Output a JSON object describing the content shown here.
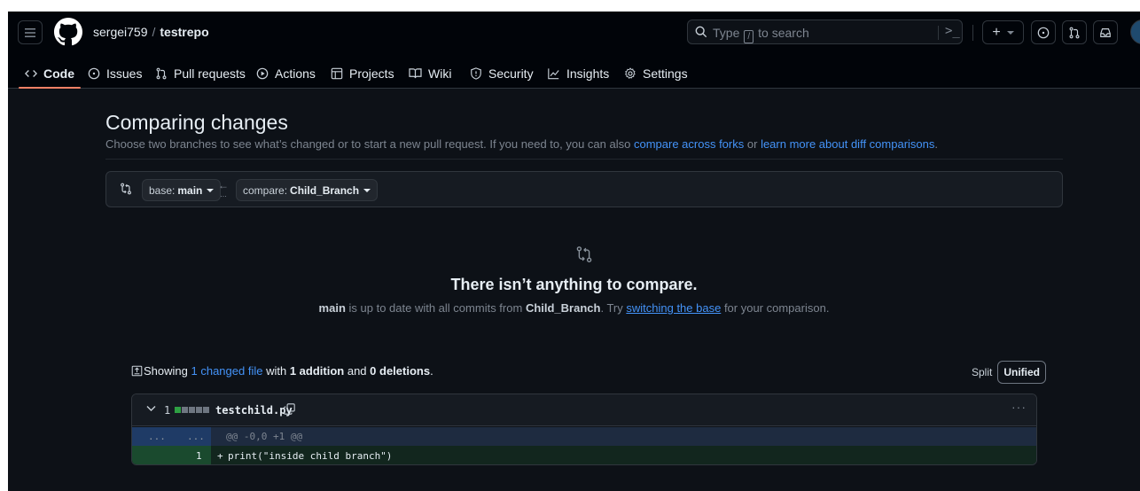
{
  "header": {
    "owner": "sergei759",
    "separator": "/",
    "repo": "testrepo",
    "search_placeholder_pre": "Type",
    "search_key": "/",
    "search_placeholder_post": "to search",
    "command_glyph": ">_",
    "plus_label": "+"
  },
  "tabs": [
    {
      "label": "Code",
      "icon": "code-icon",
      "active": true
    },
    {
      "label": "Issues",
      "icon": "issue-icon"
    },
    {
      "label": "Pull requests",
      "icon": "pull-request-icon"
    },
    {
      "label": "Actions",
      "icon": "play-icon"
    },
    {
      "label": "Projects",
      "icon": "table-icon"
    },
    {
      "label": "Wiki",
      "icon": "book-icon"
    },
    {
      "label": "Security",
      "icon": "shield-icon"
    },
    {
      "label": "Insights",
      "icon": "graph-icon"
    },
    {
      "label": "Settings",
      "icon": "gear-icon"
    }
  ],
  "compare": {
    "title": "Comparing changes",
    "subtitle_pre": "Choose two branches to see what’s changed or to start a new pull request. If you need to, you can also",
    "link_forks": "compare across forks",
    "subtitle_mid": "or",
    "link_learn": "learn more about diff comparisons",
    "subtitle_end": ".",
    "base_label": "base:",
    "base_branch": "main",
    "compare_label": "compare:",
    "compare_branch": "Child_Branch",
    "arrow": "←",
    "arrow_dots": "..."
  },
  "blank": {
    "title": "There isn’t anything to compare.",
    "desc_branch1": "main",
    "desc_mid": "is up to date with all commits from",
    "desc_branch2": "Child_Branch",
    "desc_try": ". Try",
    "desc_link": "switching the base",
    "desc_end": "for your comparison."
  },
  "summary": {
    "showing": "Showing",
    "changed_link": "1 changed file",
    "with": "with",
    "additions": "1 addition",
    "and": "and",
    "deletions": "0 deletions",
    "period": ".",
    "split_label": "Split",
    "unified_label": "Unified"
  },
  "file": {
    "change_count": "1",
    "name": "testchild.py",
    "diffstat": [
      "add",
      "neutral",
      "neutral",
      "neutral",
      "neutral"
    ],
    "menu": "···",
    "hunk_left": "...",
    "hunk_right": "...",
    "hunk_header": "@@ -0,0 +1 @@",
    "line_number": "1",
    "line_marker": "+",
    "line_code": "print(\"inside child branch\")"
  },
  "colors": {
    "background": "#0d1117",
    "header": "#010409",
    "link": "#4493f8",
    "tab_underline": "#f78166",
    "diff_add": "#2ea043"
  }
}
